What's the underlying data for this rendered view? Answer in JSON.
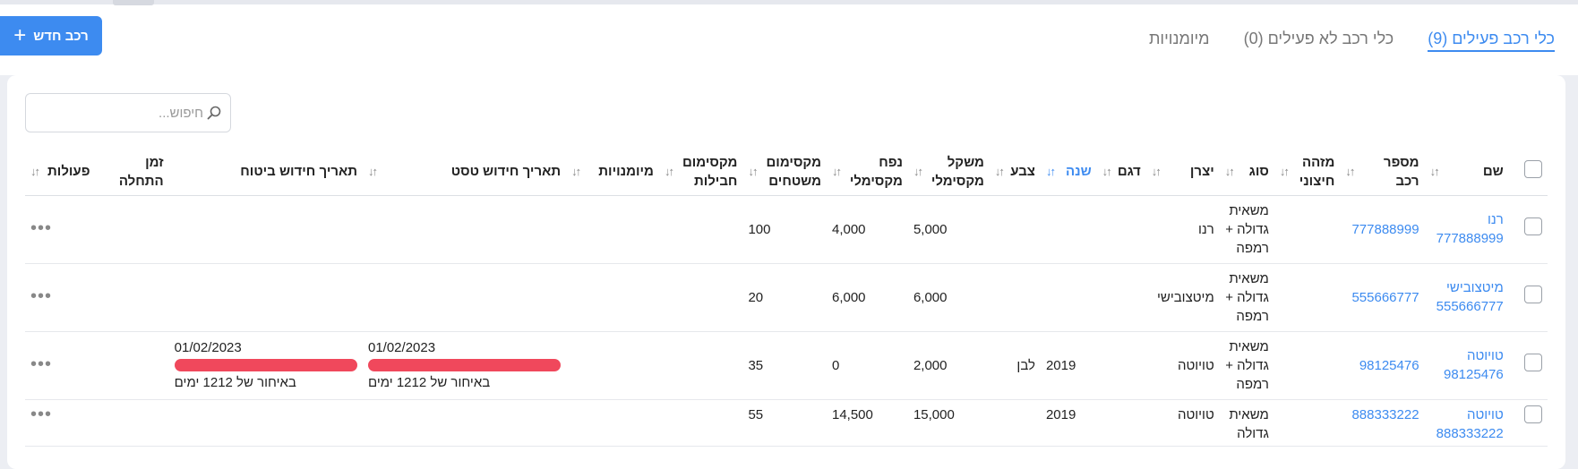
{
  "header": {
    "new_vehicle_label": "רכב חדש",
    "tabs": [
      {
        "label": "כלי רכב פעילים (9)",
        "active": true
      },
      {
        "label": "כלי רכב לא פעילים (0)",
        "active": false
      },
      {
        "label": "מיומנויות",
        "active": false
      }
    ]
  },
  "search": {
    "placeholder": "חיפוש..."
  },
  "table": {
    "columns": {
      "name": "שם",
      "vehicle_number": "מספר רכב",
      "external_id": "מזהה חיצוני",
      "type": "סוג",
      "manufacturer": "יצרן",
      "model": "דגם",
      "year": "שנה",
      "color": "צבע",
      "max_weight": "משקל מקסימלי",
      "max_volume": "נפח מקסימלי",
      "max_area": "מקסימום משטחים",
      "max_packages": "מקסימום חבילות",
      "skills": "מיומנויות",
      "test_renewal": "תאריך חידוש טסט",
      "insurance_renewal": "תאריך חידוש ביטוח",
      "start_time": "זמן התחלה",
      "actions": "פעולות"
    },
    "sort_glyph": "↑↓",
    "rows": [
      {
        "name": "רנו 777888999",
        "vehicle_number": "777888999",
        "type": "משאית גדולה + רמפה",
        "manufacturer": "רנו",
        "year": "",
        "color": "",
        "max_weight": "5,000",
        "max_volume": "4,000",
        "max_area": "100",
        "test_date": "",
        "test_late": "",
        "ins_date": "",
        "ins_late": ""
      },
      {
        "name": "מיטצובישי 555666777",
        "vehicle_number": "555666777",
        "type": "משאית גדולה + רמפה",
        "manufacturer": "מיטצובישי",
        "year": "",
        "color": "",
        "max_weight": "6,000",
        "max_volume": "6,000",
        "max_area": "20",
        "test_date": "",
        "test_late": "",
        "ins_date": "",
        "ins_late": ""
      },
      {
        "name": "טויוטה 98125476",
        "vehicle_number": "98125476",
        "type": "משאית גדולה + רמפה",
        "manufacturer": "טויוטה",
        "year": "2019",
        "color": "לבן",
        "max_weight": "2,000",
        "max_volume": "0",
        "max_area": "35",
        "test_date": "01/02/2023",
        "test_late": "באיחור של 1212 ימים",
        "ins_date": "01/02/2023",
        "ins_late": "באיחור של 1212 ימים"
      },
      {
        "name": "טויוטה 888333222",
        "vehicle_number": "888333222",
        "type": "משאית גדולה",
        "manufacturer": "טויוטה",
        "year": "2019",
        "color": "",
        "max_weight": "15,000",
        "max_volume": "14,500",
        "max_area": "55",
        "test_date": "",
        "test_late": "",
        "ins_date": "",
        "ins_late": ""
      }
    ],
    "actions_glyph": "•••"
  },
  "colors": {
    "accent": "#3d8bf0",
    "overdue": "#f0485c"
  }
}
